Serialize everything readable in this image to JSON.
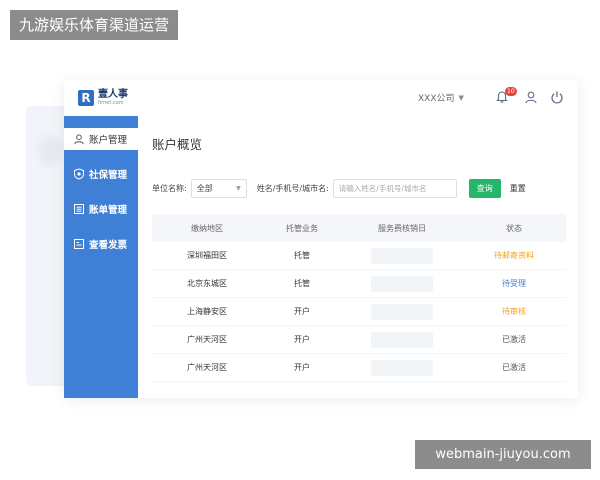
{
  "watermark": {
    "top": "九游娱乐体育渠道运营",
    "bottom": "webmain-jiuyou.com"
  },
  "logo": {
    "mark": "R",
    "name": "壹人事",
    "sub": "hrnet.com"
  },
  "header": {
    "company": "XXX公司",
    "notification_count": "10",
    "icons": [
      "bell-icon",
      "user-icon",
      "power-icon"
    ]
  },
  "sidebar": {
    "items": [
      {
        "label": "账户管理",
        "icon": "user-icon",
        "active": true
      },
      {
        "label": "社保管理",
        "icon": "shield-icon",
        "active": false
      },
      {
        "label": "账单管理",
        "icon": "list-icon",
        "active": false
      },
      {
        "label": "查看发票",
        "icon": "invoice-icon",
        "active": false
      }
    ]
  },
  "main": {
    "title": "账户概览",
    "filters": {
      "unit_label": "单位名称:",
      "unit_value": "全部",
      "search_label": "姓名/手机号/城市名:",
      "search_placeholder": "请输入姓名/手机号/城市名",
      "query_button": "查询",
      "reset_button": "重置"
    },
    "table": {
      "headers": [
        "缴纳地区",
        "托管业务",
        "服务费核销日",
        "状态"
      ],
      "rows": [
        {
          "region": "深圳福田区",
          "service": "托管",
          "date": "",
          "status": "待邮寄资料",
          "status_color": "#f0a020"
        },
        {
          "region": "北京东城区",
          "service": "托管",
          "date": "",
          "status": "待受理",
          "status_color": "#3f7fd6"
        },
        {
          "region": "上海静安区",
          "service": "开户",
          "date": "",
          "status": "待审核",
          "status_color": "#f0a020"
        },
        {
          "region": "广州天河区",
          "service": "开户",
          "date": "",
          "status": "已激活",
          "status_color": "#555555"
        },
        {
          "region": "广州天河区",
          "service": "开户",
          "date": "",
          "status": "已激活",
          "status_color": "#555555"
        }
      ]
    }
  },
  "colors": {
    "sidebar": "#3f7fd6",
    "accent_green": "#26b56b",
    "badge_red": "#e8443a"
  }
}
